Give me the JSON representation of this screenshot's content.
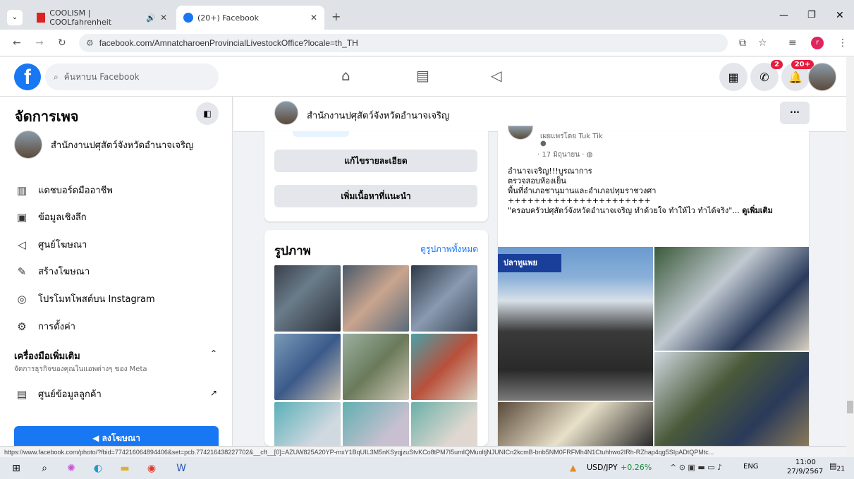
{
  "browser": {
    "tabs": [
      {
        "label": "COOLISM | COOLfahrenheit",
        "active": false
      },
      {
        "label": "(20+) Facebook",
        "active": true
      }
    ],
    "url": "facebook.com/AmnatcharoenProvincialLivestockOffice?locale=th_TH",
    "status_url": "https://www.facebook.com/photo/?fbid=774216064894406&set=pcb.774216438227702&__cft__[0]=AZUW825A20YP-mxY1BqUIL3M5nKSyqjzuStvKCo8tPM7I5umIQMuoltjNJUNICn2kcmB-bnb5NM0FRFMh4N1Ctuhhwo2IRh-RZhap4qg5SIpADtQPMtc..."
  },
  "fb_header": {
    "search_placeholder": "ค้นหาบน Facebook",
    "messenger_badge": "2",
    "notif_badge": "20+"
  },
  "sidebar": {
    "title": "จัดการเพจ",
    "page_name": "สำนักงานปศุสัตว์จังหวัดอำนาจเจริญ",
    "items": [
      {
        "label": "แดชบอร์ดมืออาชีพ",
        "icon": "dashboard-icon"
      },
      {
        "label": "ข้อมูลเชิงลึก",
        "icon": "insights-icon"
      },
      {
        "label": "ศูนย์โฆษณา",
        "icon": "megaphone-icon"
      },
      {
        "label": "สร้างโฆษณา",
        "icon": "pencil-icon"
      },
      {
        "label": "โปรโมทโพสต์บน Instagram",
        "icon": "instagram-icon"
      },
      {
        "label": "การตั้งค่า",
        "icon": "gear-icon"
      }
    ],
    "more_tools": "เครื่องมือเพิ่มเติม",
    "more_tools_sub": "จัดการธุรกิจของคุณในแอพต่างๆ ของ Meta",
    "customer_center": "ศูนย์ข้อมูลลูกค้า",
    "promote_button": "ลงโฆษณา"
  },
  "page_bar": {
    "name": "สำนักงานปศุสัตว์จังหวัดอำนาจเจริญ",
    "more": "···"
  },
  "about_card": {
    "edit_details": "แก้ไขรายละเอียด",
    "add_featured": "เพิ่มเนื้อหาที่แนะนำ"
  },
  "photos_card": {
    "title": "รูปภาพ",
    "see_all": "ดูรูปภาพทั้งหมด"
  },
  "post": {
    "shared_by": "เผยแพร่โดย Tuk Tik",
    "date": "· 17 มิถุนายน ·",
    "lines": [
      "อำนาจเจริญ!!!บูรณาการ",
      "ตรวจสอบห้องเย็น",
      "พื้นที่อำเภอชานุมานและอำเภอปทุมราชวงศา",
      "++++++++++++++++++++++"
    ],
    "quote": "\"ครอบครัวปศุสัตว์จังหวัดอำนาจเจริญ ทำด้วยใจ ทำให้ไว ทำได้จริง\"...",
    "see_more": "ดูเพิ่มเติม",
    "sign_text": "ปลาทูแพย"
  },
  "taskbar": {
    "ticker": "USD/JPY",
    "change": "+0.26%",
    "lang": "ENG",
    "time": "11:00",
    "date": "27/9/2567",
    "notif_count": "21"
  }
}
